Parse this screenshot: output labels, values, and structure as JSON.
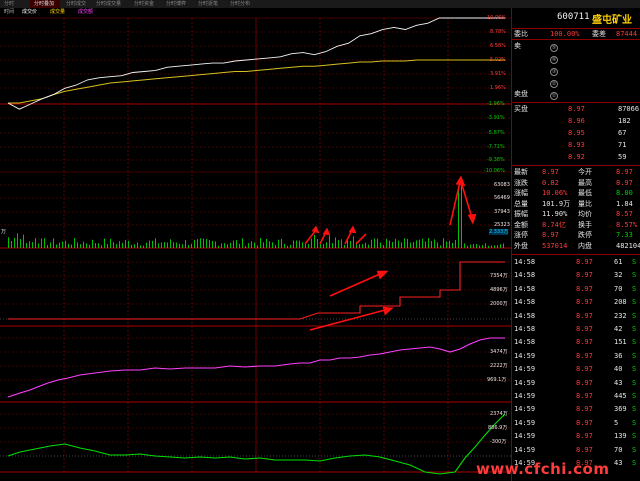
{
  "toolbar": {
    "tabs": [
      "分时",
      "分时叠加",
      "分时成交",
      "分时成交量",
      "分时资金",
      "分时博弈",
      "分时逐笔",
      "分时分布"
    ]
  },
  "legend": {
    "items": [
      "时间",
      "成交价",
      "成交量",
      "成交额"
    ]
  },
  "stock": {
    "code": "600711",
    "name": "盛屯矿业"
  },
  "webi": {
    "label1": "委比",
    "value1": "100.00%",
    "label2": "委差",
    "value2": "87444"
  },
  "sell_orders": [
    {
      "label": "卖",
      "idx": "⑤"
    },
    {
      "label": "",
      "idx": "④"
    },
    {
      "label": "",
      "idx": "③"
    },
    {
      "label": "",
      "idx": "②"
    },
    {
      "label": "卖盘",
      "idx": "①"
    }
  ],
  "buy_orders": [
    {
      "label": "买盘",
      "price": "8.97",
      "vol": "87066"
    },
    {
      "label": "",
      "price": "8.96",
      "vol": "182"
    },
    {
      "label": "",
      "price": "8.95",
      "vol": "67"
    },
    {
      "label": "",
      "price": "8.93",
      "vol": "71"
    },
    {
      "label": "",
      "price": "8.92",
      "vol": "59"
    }
  ],
  "stats": [
    {
      "l1": "最新",
      "v1": "8.97",
      "l2": "今开",
      "v2": "8.97"
    },
    {
      "l1": "涨跌",
      "v1": "0.82",
      "l2": "最高",
      "v2": "8.97"
    },
    {
      "l1": "涨幅",
      "v1": "10.06%",
      "l2": "最低",
      "v2": "8.00"
    },
    {
      "l1": "总量",
      "v1": "101.9万",
      "l2": "量比",
      "v2": "1.84"
    },
    {
      "l1": "振幅",
      "v1": "11.90%",
      "l2": "均价",
      "v2": "8.57"
    },
    {
      "l1": "金额",
      "v1": "8.74亿",
      "l2": "换手",
      "v2": "8.57%"
    },
    {
      "l1": "涨停",
      "v1": "8.97",
      "l2": "跌停",
      "v2": "7.33"
    },
    {
      "l1": "外盘",
      "v1": "537014",
      "l2": "内盘",
      "v2": "482104"
    }
  ],
  "ticks": [
    {
      "t": "14:58",
      "p": "8.97",
      "v": "61",
      "s": "S"
    },
    {
      "t": "14:58",
      "p": "8.97",
      "v": "32",
      "s": "S"
    },
    {
      "t": "14:58",
      "p": "8.97",
      "v": "70",
      "s": "S"
    },
    {
      "t": "14:58",
      "p": "8.97",
      "v": "208",
      "s": "S"
    },
    {
      "t": "14:58",
      "p": "8.97",
      "v": "232",
      "s": "S"
    },
    {
      "t": "14:58",
      "p": "8.97",
      "v": "42",
      "s": "S"
    },
    {
      "t": "14:58",
      "p": "8.97",
      "v": "151",
      "s": "S"
    },
    {
      "t": "14:59",
      "p": "8.97",
      "v": "36",
      "s": "S"
    },
    {
      "t": "14:59",
      "p": "8.97",
      "v": "40",
      "s": "S"
    },
    {
      "t": "14:59",
      "p": "8.97",
      "v": "43",
      "s": "S"
    },
    {
      "t": "14:59",
      "p": "8.97",
      "v": "445",
      "s": "S"
    },
    {
      "t": "14:59",
      "p": "8.97",
      "v": "369",
      "s": "S"
    },
    {
      "t": "14:59",
      "p": "8.97",
      "v": "5",
      "s": "S"
    },
    {
      "t": "14:59",
      "p": "8.97",
      "v": "139",
      "s": "S"
    },
    {
      "t": "14:59",
      "p": "8.97",
      "v": "70",
      "s": "S"
    },
    {
      "t": "14:59",
      "p": "8.97",
      "v": "43",
      "s": "S"
    }
  ],
  "price_axis": {
    "pct": [
      "10.06%",
      "8.78%",
      "6.58%",
      "5.02%",
      "3.91%",
      "1.96%",
      "-1.96%",
      "-3.91%",
      "-5.87%",
      "-7.71%",
      "-9.38%",
      "-10.06%"
    ]
  },
  "volume_axis": [
    "63083",
    "56469",
    "37943",
    "25323",
    "2.333万"
  ],
  "vol_left_label": "万",
  "ind1_axis": [
    "7354万",
    "4896万",
    "2000万"
  ],
  "ind2_axis": [
    "3474万",
    "2222万",
    "969.1万"
  ],
  "ind3_axis": [
    "2374万",
    "886.9万",
    "-300万"
  ],
  "chart_data": {
    "type": "line",
    "title": "",
    "xlabel": "",
    "ylabel": "",
    "series": [
      {
        "values": [
          8.16,
          8.1,
          8.15,
          8.2,
          8.24,
          8.3,
          8.33,
          8.38,
          8.4,
          8.41,
          8.42,
          8.45,
          8.46,
          8.47,
          8.5,
          8.51,
          8.52,
          8.53,
          8.54,
          8.54,
          8.56,
          8.57,
          8.58,
          8.59,
          8.6,
          8.63,
          8.64,
          8.62,
          8.65,
          8.7,
          8.73,
          8.8,
          8.82,
          8.86,
          8.88,
          8.86,
          8.9,
          8.92,
          8.97,
          8.97,
          8.97
        ]
      },
      {
        "values": [
          8.16,
          8.16,
          8.18,
          8.2,
          8.24,
          8.27,
          8.29,
          8.31,
          8.33,
          8.35,
          8.36,
          8.37,
          8.38,
          8.39,
          8.4,
          8.41,
          8.42,
          8.43,
          8.44,
          8.45,
          8.46,
          8.46,
          8.47,
          8.48,
          8.49,
          8.5,
          8.51,
          8.51,
          8.52,
          8.53,
          8.54,
          8.55,
          8.55,
          8.56,
          8.56,
          8.56,
          8.57,
          8.57,
          8.57,
          8.57,
          8.57
        ]
      }
    ],
    "ylim": [
      7.33,
      8.97
    ]
  },
  "watermark": "www.cfchi.com"
}
